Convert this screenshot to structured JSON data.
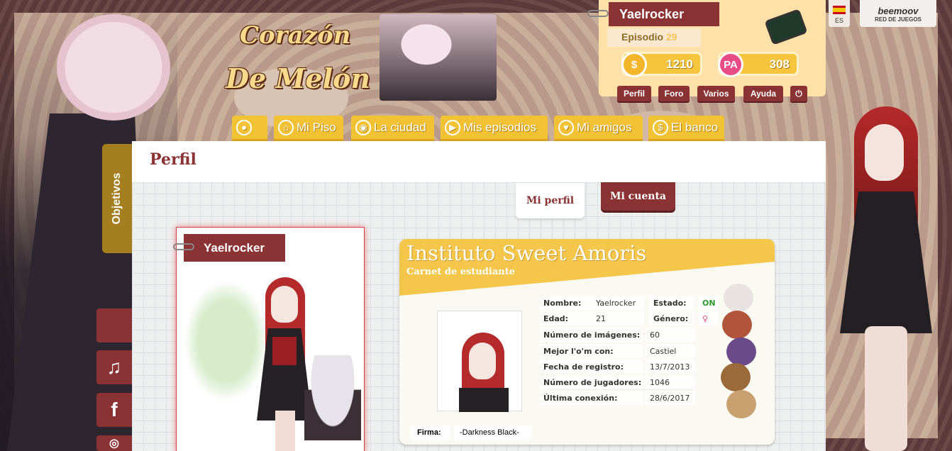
{
  "header": {
    "logo_line1": "Corazón",
    "logo_line2": "De Melón"
  },
  "user": {
    "name": "Yaelrocker",
    "episode_label": "Episodio",
    "episode_number": "29",
    "coins": "1210",
    "pa": "308",
    "coin_icon": "$",
    "pa_icon": "PA"
  },
  "user_menu": [
    "Perfil",
    "Foro",
    "Varios",
    "Ayuda"
  ],
  "language": "ES",
  "network": {
    "brand": "beemoov",
    "label": "RED DE JUEGOS"
  },
  "nav": [
    {
      "label": "",
      "icon": "candy-icon"
    },
    {
      "label": "Mi Piso",
      "icon": "house-icon"
    },
    {
      "label": "La ciudad",
      "icon": "map-pin-icon"
    },
    {
      "label": "Mis episodios",
      "icon": "play-icon"
    },
    {
      "label": "Mi amigos",
      "icon": "heart-icon"
    },
    {
      "label": "El banco",
      "icon": "dollar-icon"
    }
  ],
  "side": {
    "objetivos": "Objetivos",
    "music_icon": "♫",
    "facebook_icon": "f"
  },
  "page": {
    "title": "Perfil",
    "tab_mi_perfil": "Mi perfil",
    "tab_mi_cuenta": "Mi cuenta"
  },
  "avatar": {
    "name": "Yaelrocker"
  },
  "id_card": {
    "title": "Instituto Sweet Amoris",
    "subtitle": "Carnet de estudiante",
    "nombre_label": "Nombre:",
    "nombre": "Yaelrocker",
    "estado_label": "Estado:",
    "estado": "ON",
    "edad_label": "Edad:",
    "edad": "21",
    "genero_label": "Género:",
    "genero": "♀",
    "imagenes_label": "Número de imágenes:",
    "imagenes": "60",
    "mejor_label": "Mejor l'o'm con:",
    "mejor": "Castiel",
    "registro_label": "Fecha de registro:",
    "registro": "13/7/2013",
    "jugadores_label": "Número de jugadores:",
    "jugadores": "1046",
    "conexion_label": "Última conexión:",
    "conexion": "28/6/2017",
    "firma_label": "Firma:",
    "firma": "-Darkness Black-"
  }
}
